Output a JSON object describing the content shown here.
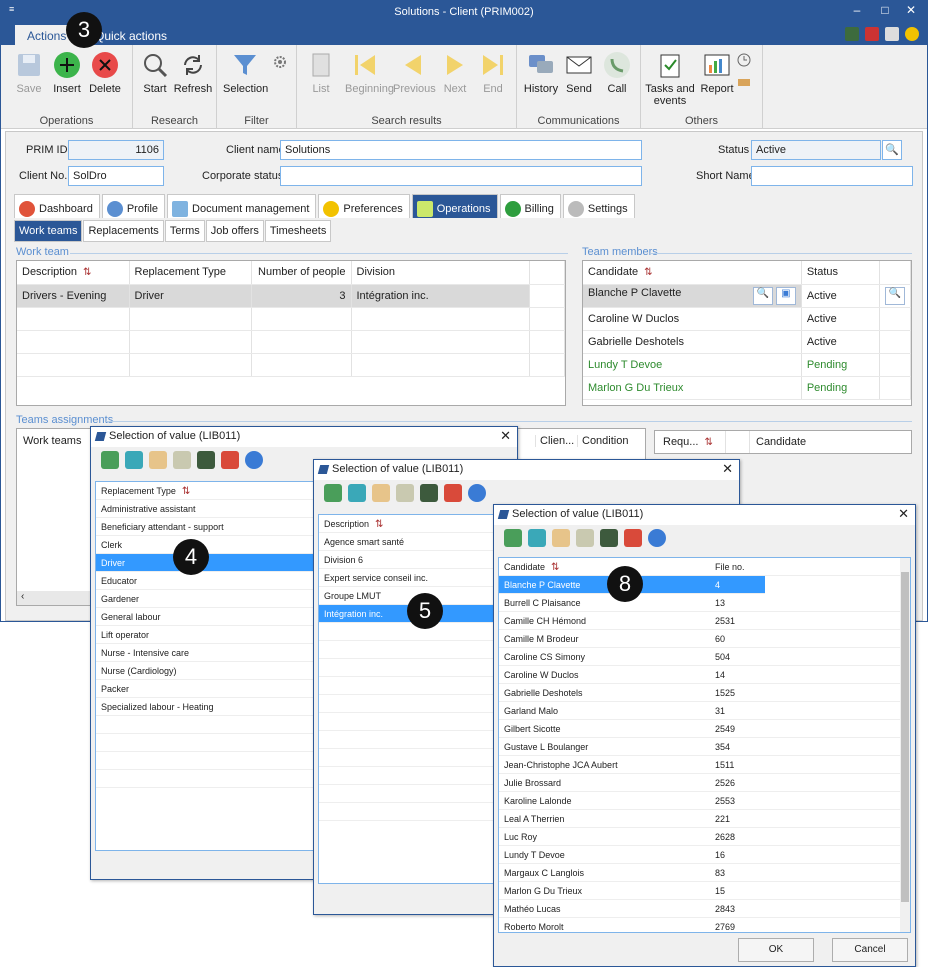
{
  "window": {
    "title": "Solutions - Client (PRIM002)",
    "qa": "≡",
    "controls": [
      "–",
      "□",
      "✕"
    ]
  },
  "ribbon": {
    "tabs": [
      "Actions",
      "Quick actions"
    ],
    "groups": [
      {
        "label": "Operations",
        "buttons": [
          {
            "label": "Save",
            "disabled": true
          },
          {
            "label": "Insert"
          },
          {
            "label": "Delete"
          }
        ]
      },
      {
        "label": "Research",
        "buttons": [
          {
            "label": "Start"
          },
          {
            "label": "Refresh"
          }
        ]
      },
      {
        "label": "Filter",
        "buttons": [
          {
            "label": "Selection"
          }
        ]
      },
      {
        "label": "Search results",
        "buttons": [
          {
            "label": "List",
            "disabled": true
          },
          {
            "label": "Beginning",
            "disabled": true
          },
          {
            "label": "Previous",
            "disabled": true
          },
          {
            "label": "Next",
            "disabled": true
          },
          {
            "label": "End",
            "disabled": true
          }
        ]
      },
      {
        "label": "Communications",
        "buttons": [
          {
            "label": "History"
          },
          {
            "label": "Send"
          },
          {
            "label": "Call"
          }
        ]
      },
      {
        "label": "Others",
        "buttons": [
          {
            "label": "Tasks and events"
          },
          {
            "label": "Report"
          }
        ]
      }
    ]
  },
  "form": {
    "prim_id_label": "PRIM ID",
    "prim_id": "1106",
    "client_name_label": "Client name",
    "client_name": "Solutions",
    "status_label": "Status",
    "status": "Active",
    "client_no_label": "Client No.",
    "client_no": "SolDro",
    "corporate_status_label": "Corporate status",
    "corporate_status": "",
    "short_name_label": "Short Name",
    "short_name": ""
  },
  "tabs": [
    "Dashboard",
    "Profile",
    "Document management",
    "Preferences",
    "Operations",
    "Billing",
    "Settings"
  ],
  "subtabs": [
    "Work teams",
    "Replacements",
    "Terms",
    "Job offers",
    "Timesheets"
  ],
  "work_team": {
    "title": "Work team",
    "headers": [
      "Description",
      "Replacement Type",
      "Number of people",
      "Division"
    ],
    "rows": [
      [
        "Drivers - Evening",
        "Driver",
        "3",
        "Intégration inc."
      ]
    ]
  },
  "team_members": {
    "title": "Team members",
    "headers": [
      "Candidate",
      "Status"
    ],
    "rows": [
      [
        "Blanche P Clavette",
        "Active"
      ],
      [
        "Caroline W Duclos",
        "Active"
      ],
      [
        "Gabrielle Deshotels",
        "Active"
      ],
      [
        "Lundy T Devoe",
        "Pending"
      ],
      [
        "Marlon G Du Trieux",
        "Pending"
      ]
    ]
  },
  "teams_assign": {
    "title": "Teams assignments",
    "headers": [
      "Work teams",
      "Clien...",
      "Condition",
      "Requ...",
      "Candidate"
    ]
  },
  "dialog1": {
    "title": "Selection of value (LIB011)",
    "header": "Replacement Type",
    "items": [
      "Administrative assistant",
      "Beneficiary attendant - support",
      "Clerk",
      "Driver",
      "Educator",
      "Gardener",
      "General labour",
      "Lift operator",
      "Nurse - Intensive care",
      "Nurse (Cardiology)",
      "Packer",
      "Specialized labour - Heating"
    ],
    "selected": 3
  },
  "dialog2": {
    "title": "Selection of value (LIB011)",
    "header": "Description",
    "items": [
      "Agence smart santé",
      "Division 6",
      "Expert service conseil inc.",
      "Groupe LMUT",
      "Intégration inc."
    ],
    "selected": 4
  },
  "dialog3": {
    "title": "Selection of value (LIB011)",
    "headers": [
      "Candidate",
      "File no."
    ],
    "rows": [
      [
        "Blanche P Clavette",
        "4"
      ],
      [
        "Burrell C Plaisance",
        "13"
      ],
      [
        "Camille CH Hémond",
        "2531"
      ],
      [
        "Camille M Brodeur",
        "60"
      ],
      [
        "Caroline CS Simony",
        "504"
      ],
      [
        "Caroline W Duclos",
        "14"
      ],
      [
        "Gabrielle Deshotels",
        "1525"
      ],
      [
        "Garland Malo",
        "31"
      ],
      [
        "Gilbert Sicotte",
        "2549"
      ],
      [
        "Gustave L Boulanger",
        "354"
      ],
      [
        "Jean-Christophe JCA Aubert",
        "1511"
      ],
      [
        "Julie Brossard",
        "2526"
      ],
      [
        "Karoline Lalonde",
        "2553"
      ],
      [
        "Leal A Therrien",
        "221"
      ],
      [
        "Luc Roy",
        "2628"
      ],
      [
        "Lundy T Devoe",
        "16"
      ],
      [
        "Margaux C Langlois",
        "83"
      ],
      [
        "Marlon G Du Trieux",
        "15"
      ],
      [
        "Mathéo Lucas",
        "2843"
      ],
      [
        "Roberto Morolt",
        "2769"
      ]
    ],
    "ok": "OK",
    "cancel": "Cancel"
  },
  "callouts": [
    "3",
    "4",
    "5",
    "8"
  ]
}
